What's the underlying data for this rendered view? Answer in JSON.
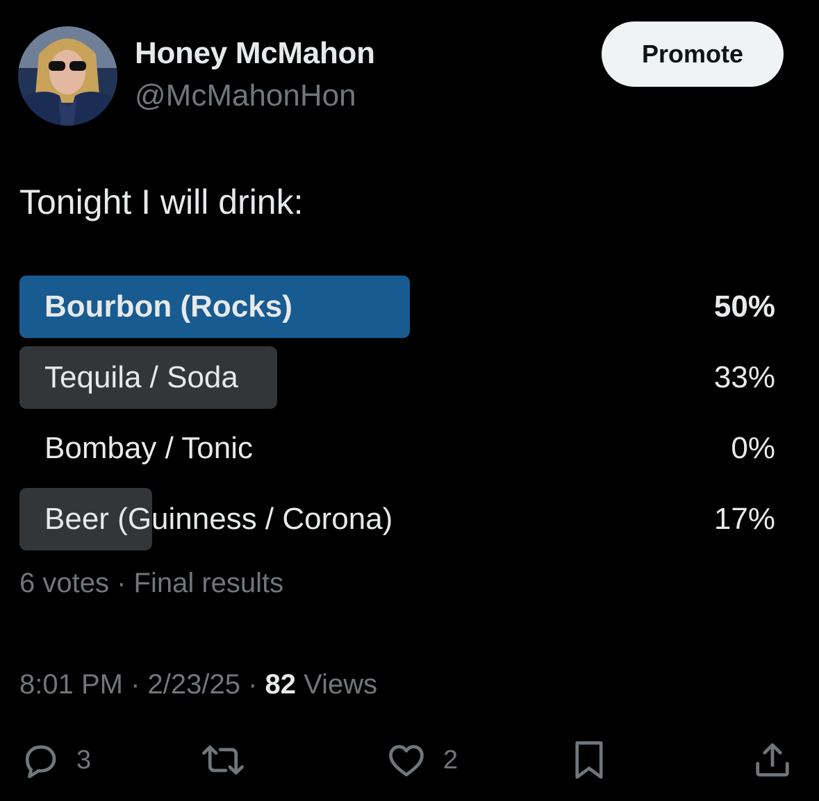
{
  "author": {
    "display_name": "Honey McMahon",
    "handle": "@McMahonHon",
    "avatar": "profile-photo"
  },
  "header": {
    "promote_label": "Promote"
  },
  "tweet": {
    "text": "Tonight I will drink:"
  },
  "poll": {
    "options": [
      {
        "label": "Bourbon (Rocks)",
        "percent_text": "50%",
        "percent": 50,
        "winner": true
      },
      {
        "label": "Tequila / Soda",
        "percent_text": "33%",
        "percent": 33,
        "winner": false
      },
      {
        "label": "Bombay / Tonic",
        "percent_text": "0%",
        "percent": 0,
        "winner": false
      },
      {
        "label": "Beer (Guinness / Corona)",
        "percent_text": "17%",
        "percent": 17,
        "winner": false
      }
    ],
    "votes": "6 votes",
    "separator": " · ",
    "status": "Final results"
  },
  "meta": {
    "time": "8:01 PM",
    "date": "2/23/25",
    "separator": " · ",
    "views_count": "82",
    "views_label": " Views"
  },
  "actions": {
    "reply_count": "3",
    "like_count": "2",
    "icons": [
      "reply-icon",
      "retweet-icon",
      "like-icon",
      "bookmark-icon",
      "share-icon"
    ]
  },
  "colors": {
    "background": "#000000",
    "winner_bar": "#175b91",
    "bar": "#333639",
    "secondary_text": "#71767b",
    "primary_text": "#e7e9ea",
    "promote_bg": "#eff3f4"
  }
}
